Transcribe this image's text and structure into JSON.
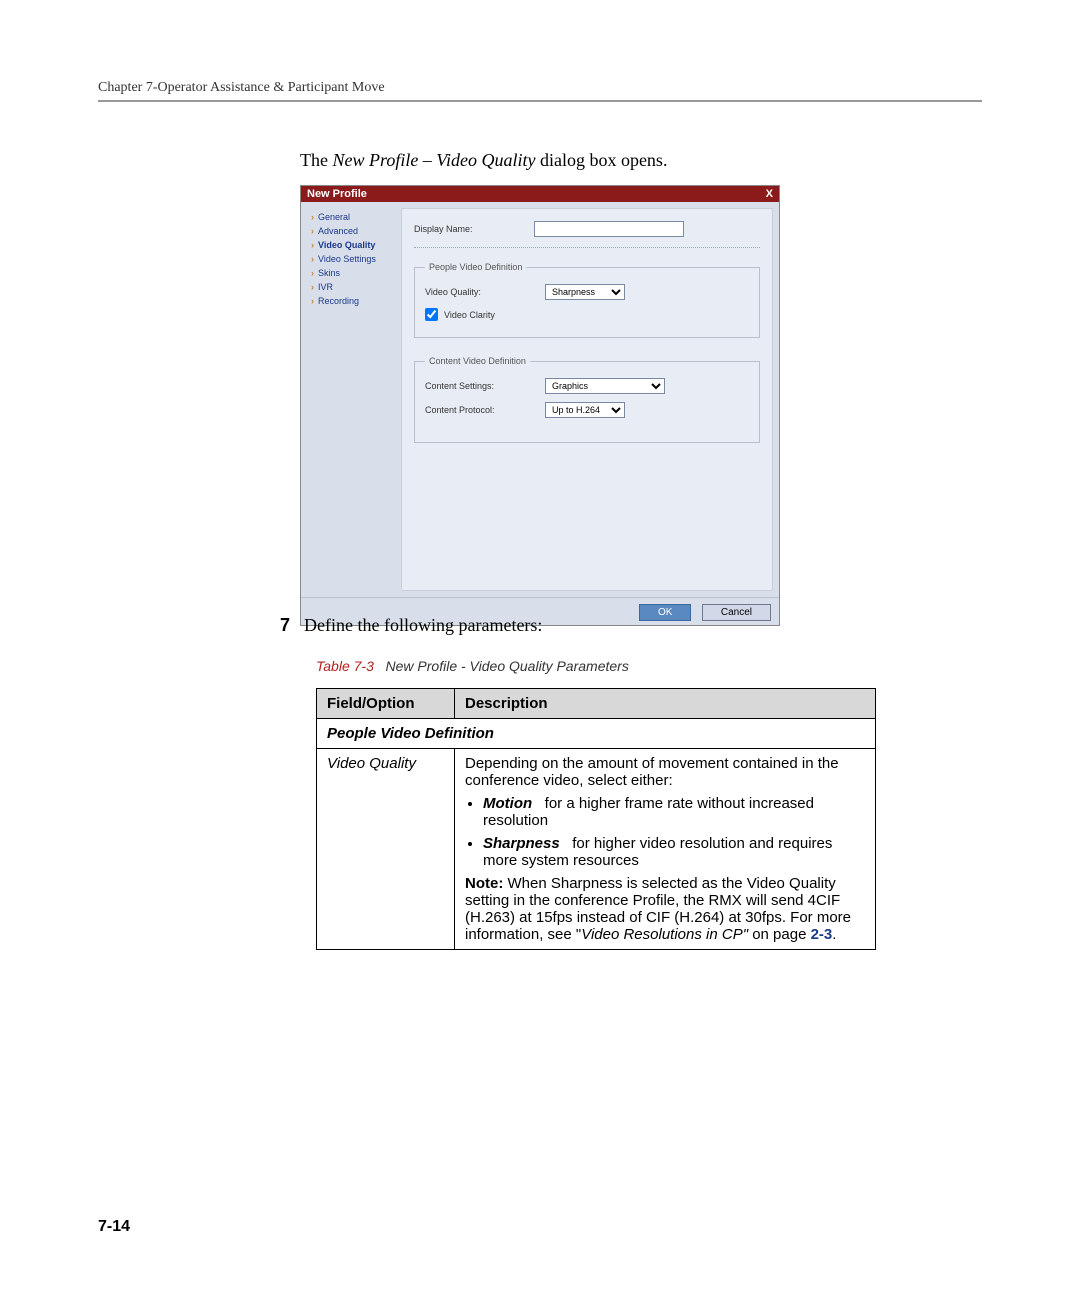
{
  "header": "Chapter 7-Operator Assistance & Participant Move",
  "intro": {
    "prefix": "The ",
    "italic": "New Profile – Video Quality",
    "suffix": " dialog box opens."
  },
  "dialog": {
    "title": "New Profile",
    "close_icon": "X",
    "sidebar": [
      {
        "label": "General"
      },
      {
        "label": "Advanced"
      },
      {
        "label": "Video Quality"
      },
      {
        "label": "Video Settings"
      },
      {
        "label": "Skins"
      },
      {
        "label": "IVR"
      },
      {
        "label": "Recording"
      }
    ],
    "display_name_label": "Display Name:",
    "display_name_value": "",
    "people_legend": "People Video Definition",
    "vq_label": "Video Quality:",
    "vq_value": "Sharpness",
    "vc_label": "Video Clarity",
    "content_legend": "Content Video Definition",
    "cs_label": "Content Settings:",
    "cs_value": "Graphics",
    "cp_label": "Content Protocol:",
    "cp_value": "Up to H.264",
    "ok": "OK",
    "cancel": "Cancel"
  },
  "step": {
    "num": "7",
    "text": "Define the following parameters:"
  },
  "table_caption": {
    "label": "Table 7-3",
    "text": "New Profile - Video Quality Parameters"
  },
  "table": {
    "h1": "Field/Option",
    "h2": "Description",
    "section": "People Video Definition",
    "r1field": "Video Quality",
    "r1_intro": "Depending on the amount of movement contained in the conference video, select either:",
    "r1_b1a": "Motion",
    "r1_b1b": " for a higher frame rate without increased resolution",
    "r1_b2a": "Sharpness",
    "r1_b2b": " for higher video resolution and requires more system resources",
    "r1_note_label": "Note:",
    "r1_note": " When Sharpness is selected as the Video Quality setting in the conference Profile, the RMX will send 4CIF (H.263) at 15fps instead of CIF (H.264) at 30fps. For more information, see \"",
    "r1_ref": "Video Resolutions in CP\"",
    "r1_onpage": " on page ",
    "r1_pagenum": "2-3",
    "r1_period": "."
  },
  "page_num": "7-14"
}
